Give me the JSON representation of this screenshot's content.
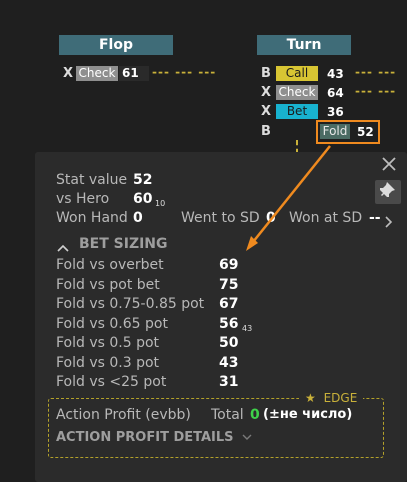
{
  "streets": {
    "flop": "Flop",
    "turn": "Turn"
  },
  "flop_row": {
    "letter": "X",
    "action": "Check",
    "value": "61",
    "dashes": "--- --- ---"
  },
  "turn_rows": [
    {
      "letter": "B",
      "action": "Call",
      "value": "43",
      "dashes": "--- ---",
      "color": "#d8c533",
      "text_color": "#1b1b1b"
    },
    {
      "letter": "X",
      "action": "Check",
      "value": "64",
      "dashes": "--- ---",
      "color": "#8f8f8f",
      "text_color": "#ffffff"
    },
    {
      "letter": "X",
      "action": "Bet",
      "value": "36",
      "dashes": "",
      "color": "#18b2cf",
      "text_color": "#1b1b1b"
    },
    {
      "letter": "B",
      "action": "Fold",
      "value": "52",
      "dashes": "",
      "color": "#4b6b63",
      "text_color": "#e8e8e8"
    }
  ],
  "popup": {
    "stat_label": "Stat value",
    "stat_value": "52",
    "vs_hero_label": "vs Hero",
    "vs_hero_value": "60",
    "vs_hero_sub": "10",
    "won_hand_label": "Won Hand",
    "won_hand_value": "0",
    "went_sd_label": "Went to SD",
    "went_sd_value": "0",
    "won_sd_label": "Won at SD",
    "won_sd_value": "--",
    "section_title": "BET SIZING",
    "bet_rows": [
      {
        "label": "Fold vs overbet",
        "value": "69",
        "sub": ""
      },
      {
        "label": "Fold vs pot bet",
        "value": "75",
        "sub": ""
      },
      {
        "label": "Fold vs 0.75-0.85 pot",
        "value": "67",
        "sub": ""
      },
      {
        "label": "Fold vs 0.65 pot",
        "value": "56",
        "sub": "43"
      },
      {
        "label": "Fold vs 0.5 pot",
        "value": "50",
        "sub": ""
      },
      {
        "label": "Fold vs 0.3 pot",
        "value": "43",
        "sub": ""
      },
      {
        "label": "Fold vs <25 pot",
        "value": "31",
        "sub": ""
      }
    ],
    "edge_label": "EDGE",
    "action_profit_label": "Action Profit (evbb)",
    "total_label": "Total",
    "total_value": "0",
    "total_note": "(±не число)",
    "details_label": "ACTION PROFIT DETAILS"
  },
  "colors": {
    "header_bg": "#3f6c78",
    "highlight_orange": "#ef8a1f",
    "edge_gold": "#c9b13a",
    "total_green": "#3fd14a"
  }
}
